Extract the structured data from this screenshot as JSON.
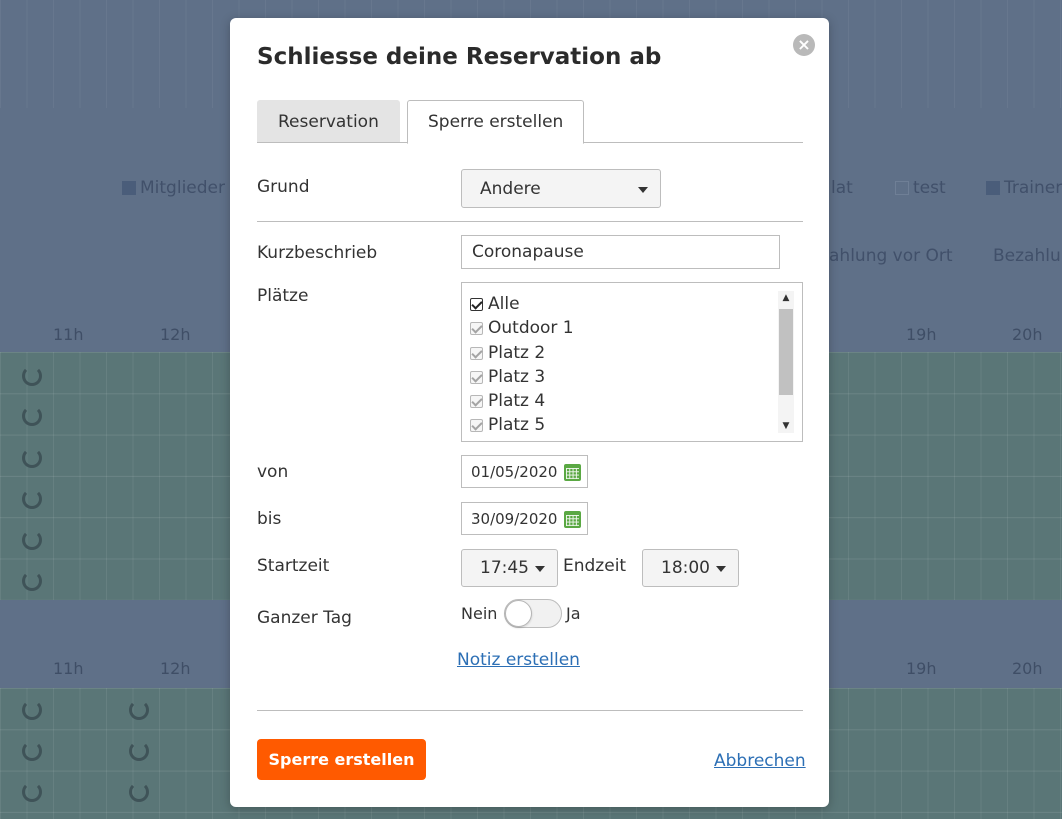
{
  "background": {
    "legend": [
      "Mitglieder",
      "lat",
      "test",
      "Trainer"
    ],
    "payment": [
      "ahlung vor Ort",
      "Bezahlu"
    ],
    "hours_left": [
      "11h",
      "12h"
    ],
    "hours_right": [
      "19h",
      "20h"
    ]
  },
  "modal": {
    "title": "Schliesse deine Reservation ab",
    "close_icon": "×",
    "tabs": [
      "Reservation",
      "Sperre erstellen"
    ],
    "active_tab": "Sperre erstellen"
  },
  "form": {
    "grund": {
      "label": "Grund",
      "value": "Andere"
    },
    "kurzbeschrieb": {
      "label": "Kurzbeschrieb",
      "value": "Coronapause"
    },
    "plaetze": {
      "label": "Plätze",
      "items": [
        {
          "label": "Alle",
          "checked": true
        },
        {
          "label": "Outdoor 1",
          "checked": true
        },
        {
          "label": "Platz 2",
          "checked": true
        },
        {
          "label": "Platz 3",
          "checked": true
        },
        {
          "label": "Platz 4",
          "checked": true
        },
        {
          "label": "Platz 5",
          "checked": true
        }
      ]
    },
    "von": {
      "label": "von",
      "value": "01/05/2020"
    },
    "bis": {
      "label": "bis",
      "value": "30/09/2020"
    },
    "startzeit": {
      "label": "Startzeit",
      "value": "17:45"
    },
    "endzeit": {
      "label": "Endzeit",
      "value": "18:00"
    },
    "ganzer_tag": {
      "label": "Ganzer Tag",
      "off_label": "Nein",
      "on_label": "Ja",
      "value": false
    },
    "note_link": "Notiz erstellen"
  },
  "footer": {
    "submit_label": "Sperre erstellen",
    "cancel_label": "Abbrechen"
  },
  "colors": {
    "primary_button": "#ff5a00",
    "link": "#2c6fb5",
    "calendar_icon": "#5aa843"
  }
}
